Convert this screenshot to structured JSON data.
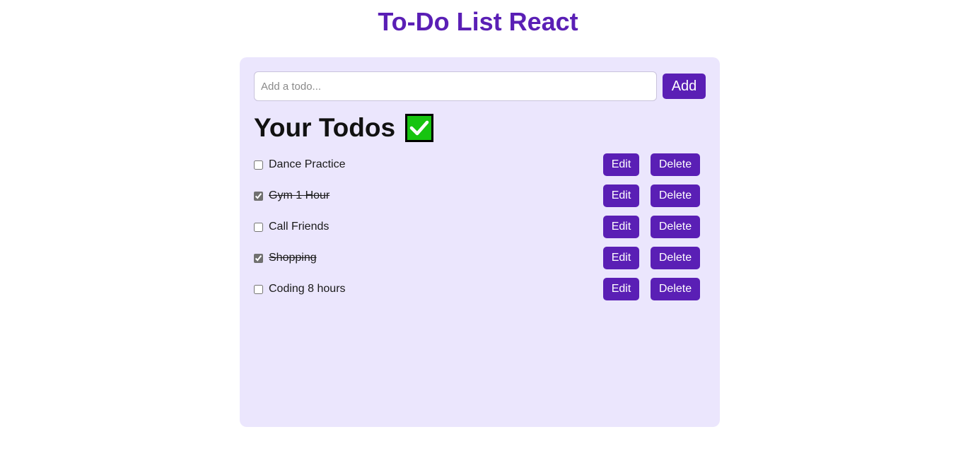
{
  "header": {
    "title": "To-Do List React"
  },
  "input": {
    "placeholder": "Add a todo...",
    "value": "",
    "add_label": "Add"
  },
  "section": {
    "title": "Your Todos",
    "icon": "check-mark-icon"
  },
  "todos": [
    {
      "text": "Dance Practice",
      "completed": false,
      "edit_label": "Edit",
      "delete_label": "Delete"
    },
    {
      "text": "Gym 1 Hour",
      "completed": true,
      "edit_label": "Edit",
      "delete_label": "Delete"
    },
    {
      "text": "Call Friends",
      "completed": false,
      "edit_label": "Edit",
      "delete_label": "Delete"
    },
    {
      "text": "Shopping",
      "completed": true,
      "edit_label": "Edit",
      "delete_label": "Delete"
    },
    {
      "text": "Coding 8 hours",
      "completed": false,
      "edit_label": "Edit",
      "delete_label": "Delete"
    }
  ],
  "colors": {
    "accent": "#5a1fb5",
    "panel": "#ebe6fd",
    "check_icon": "#17c410"
  }
}
